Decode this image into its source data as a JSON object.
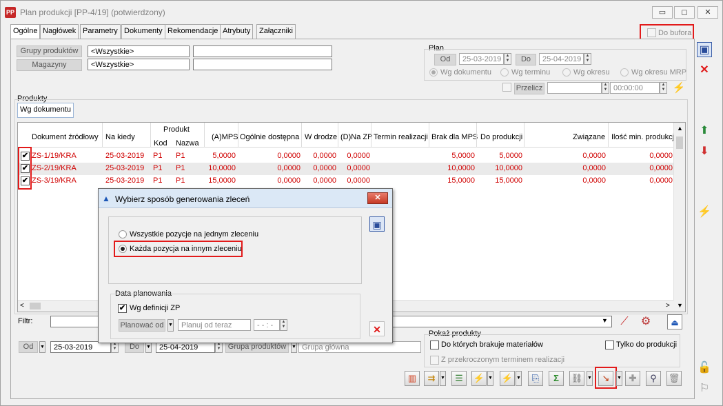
{
  "window": {
    "app_icon": "PP",
    "title": "Plan produkcji [PP-4/19]  (potwierdzony)",
    "minimize": "▭",
    "maximize": "◻",
    "close": "✕"
  },
  "tabs": [
    "Ogólne",
    "Nagłówek",
    "Parametry",
    "Dokumenty",
    "Rekomendacje",
    "Atrybuty",
    "Załączniki"
  ],
  "do_bufora": "Do bufora",
  "filters": {
    "grupy_produktow_label": "Grupy produktów",
    "grupy_produktow_value": "<Wszystkie>",
    "magazyny_label": "Magazyny",
    "magazyny_value": "<Wszystkie>"
  },
  "plan": {
    "title": "Plan",
    "od_label": "Od",
    "od_value": "25-03-2019",
    "do_label": "Do",
    "do_value": "25-04-2019",
    "radios": [
      "Wg dokumentu",
      "Wg terminu",
      "Wg okresu",
      "Wg okresu MRP"
    ],
    "przelicz_label": "Przelicz",
    "time_value": "00:00:00"
  },
  "products": {
    "group_label": "Produkty",
    "subtab": "Wg dokumentu",
    "headers": {
      "dokument": "Dokument źródłowy",
      "na_kiedy": "Na kiedy",
      "produkt": "Produkt",
      "kod": "Kod",
      "nazwa": "Nazwa",
      "amps": "(A)MPS",
      "ogolnie": "Ogólnie dostępna",
      "w_drodze": "W drodze",
      "dna_zp": "(D)Na ZP",
      "termin": "Termin realizacji",
      "brak": "Brak dla MPS",
      "do_produkcji": "Do produkcji",
      "zwiazane": "Związane",
      "ilosc_min": "Ilość min. produkcji"
    },
    "rows": [
      {
        "check": "✔",
        "dok": "ZS-1/19/KRA",
        "data": "25-03-2019",
        "kod": "P1",
        "nazwa": "P1",
        "amps": "5,0000",
        "ogolnie": "0,0000",
        "wdrodze": "0,0000",
        "nazp": "0,0000",
        "brak": "5,0000",
        "doprod": "5,0000",
        "zwiazane": "0,0000",
        "ilmin": "0,0000"
      },
      {
        "check": "✔",
        "dok": "ZS-2/19/KRA",
        "data": "25-03-2019",
        "kod": "P1",
        "nazwa": "P1",
        "amps": "10,0000",
        "ogolnie": "0,0000",
        "wdrodze": "0,0000",
        "nazp": "0,0000",
        "brak": "10,0000",
        "doprod": "10,0000",
        "zwiazane": "0,0000",
        "ilmin": "0,0000"
      },
      {
        "check": "✔",
        "dok": "ZS-3/19/KRA",
        "data": "25-03-2019",
        "kod": "P1",
        "nazwa": "P1",
        "amps": "15,0000",
        "ogolnie": "0,0000",
        "wdrodze": "0,0000",
        "nazp": "0,0000",
        "brak": "15,0000",
        "doprod": "15,0000",
        "zwiazane": "0,0000",
        "ilmin": "0,0000"
      }
    ]
  },
  "filtr_label": "Filtr:",
  "bottom": {
    "od_label": "Od",
    "od_value": "25-03-2019",
    "do_label": "Do",
    "do_value": "25-04-2019",
    "grupa_label": "Grupa produktów",
    "grupa_value": "Grupa główna",
    "pokaz_title": "Pokaż produkty",
    "chk_braki": "Do których brakuje materiałów",
    "chk_tylko": "Tylko do produkcji",
    "chk_termin": "Z przekroczonym terminem realizacji"
  },
  "dialog": {
    "title": "Wybierz sposób generowania zleceń",
    "option_all": "Wszystkie pozycje na jednym zleceniu",
    "option_each": "Każda pozycja na innym zleceniu",
    "data_planowania": "Data planowania",
    "wg_definicji": "Wg definicji ZP",
    "planowac_od": "Planować od",
    "planuj_od_teraz": "Planuj od teraz",
    "time_value": "- - : -",
    "close": "✕"
  },
  "colors": {
    "highlight": "#e21a1a",
    "row_text": "#d00000"
  }
}
